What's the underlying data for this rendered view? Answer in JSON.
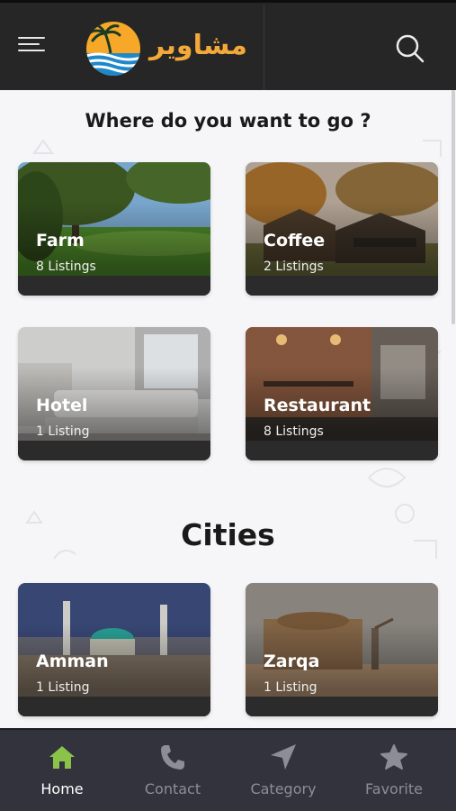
{
  "header": {
    "brand": "مشاوير",
    "menu_icon": "hamburger-menu-icon",
    "search_icon": "search-icon",
    "logo": "palm-sunset-logo"
  },
  "main": {
    "heading": "Where do you want to go ?",
    "categories": [
      {
        "title": "Farm",
        "count": "8 Listings"
      },
      {
        "title": "Coffee",
        "count": "2 Listings"
      },
      {
        "title": "Hotel",
        "count": "1 Listing"
      },
      {
        "title": "Restaurant",
        "count": "8 Listings"
      }
    ],
    "cities_title": "Cities",
    "cities": [
      {
        "title": "Amman",
        "count": "1 Listing"
      },
      {
        "title": "Zarqa",
        "count": "1 Listing"
      }
    ]
  },
  "nav": {
    "items": [
      {
        "label": "Home",
        "icon": "home-icon",
        "active": true
      },
      {
        "label": "Contact",
        "icon": "phone-icon",
        "active": false
      },
      {
        "label": "Category",
        "icon": "navigation-arrow-icon",
        "active": false
      },
      {
        "label": "Favorite",
        "icon": "star-icon",
        "active": false
      }
    ]
  },
  "colors": {
    "topbar": "#262626",
    "brand": "#f3a93a",
    "content_bg": "#f6f6f8",
    "nav_bg": "#33333d",
    "nav_active_icon": "#8bc34a",
    "nav_inactive": "#8d8d95"
  }
}
